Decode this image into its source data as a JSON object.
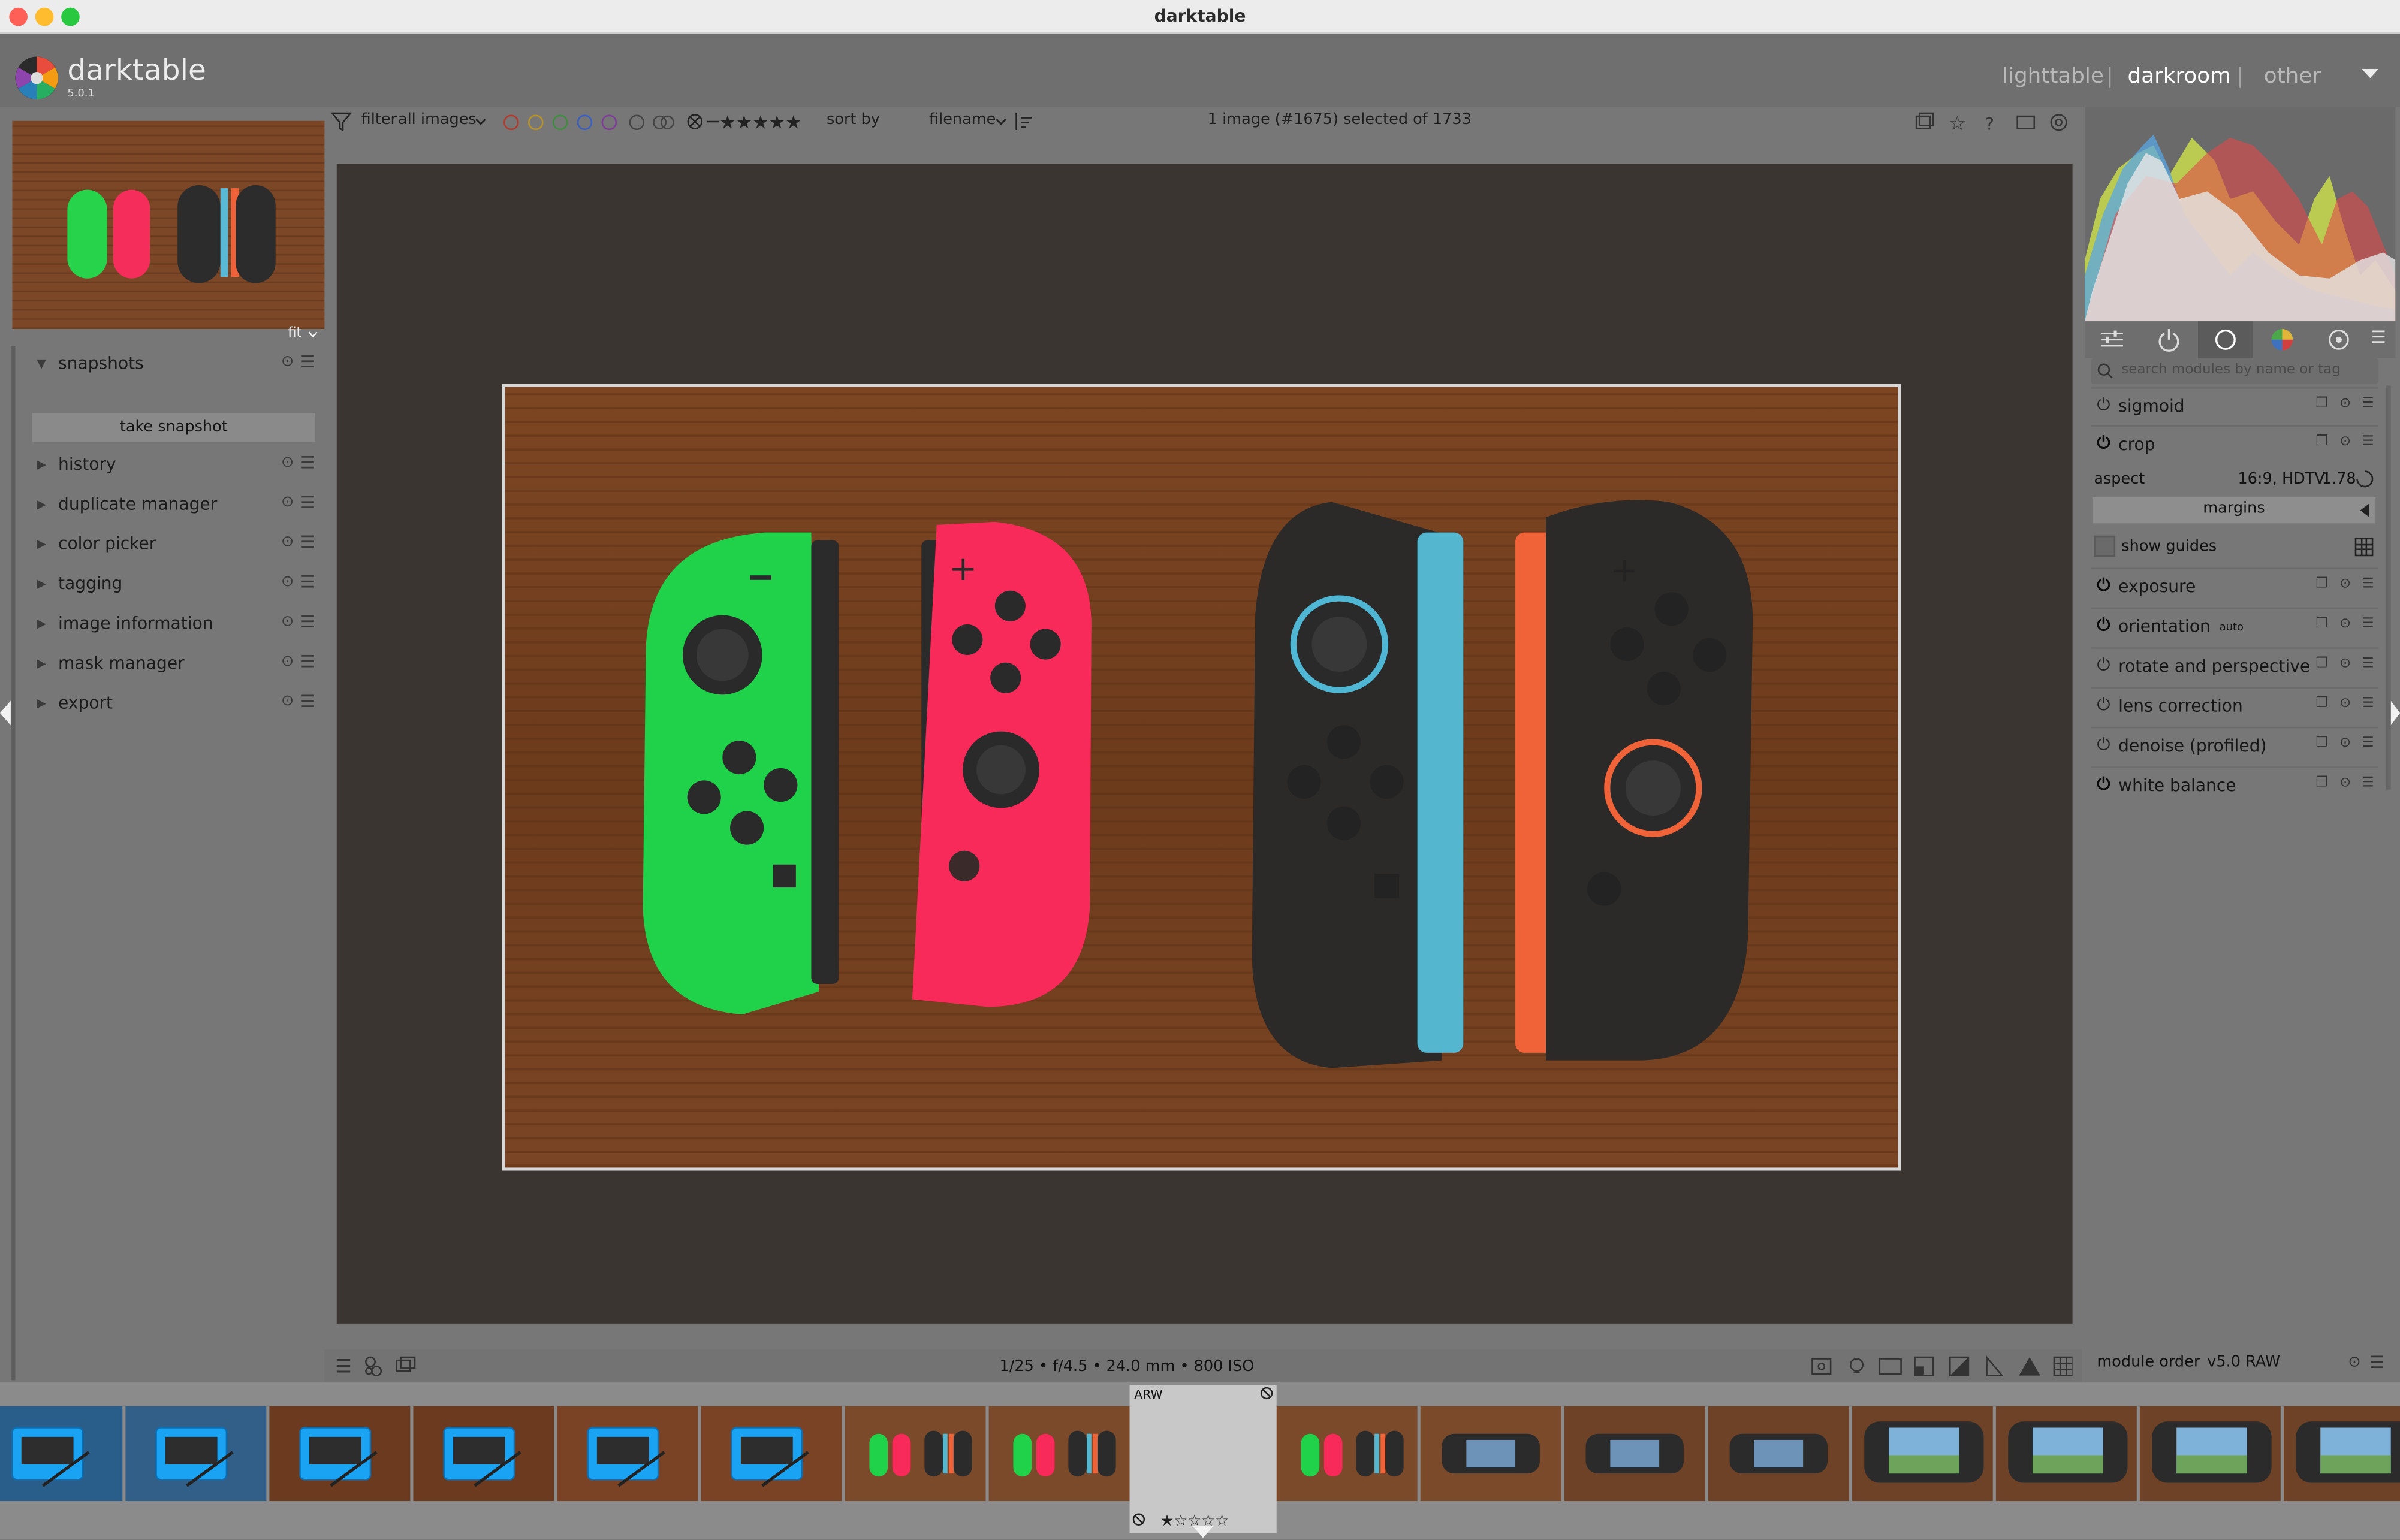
{
  "window": {
    "title": "darktable"
  },
  "app": {
    "name": "darktable",
    "version": "5.0.1"
  },
  "views": {
    "lighttable": "lighttable",
    "darkroom": "darkroom",
    "other": "other",
    "sep": "|"
  },
  "toolbar": {
    "filter_label": "filter",
    "filter_value": "all images",
    "sort_label": "sort by",
    "sort_value": "filename",
    "status": "1 image (#1675) selected of 1733"
  },
  "colors": {
    "panel": "#777777",
    "header": "#6f6f6f",
    "center_bg": "#3b3532",
    "accent_active": "#ffffff",
    "labels": [
      "#c0392b",
      "#c9a227",
      "#3f9b3f",
      "#3b5fc0",
      "#8e44ad"
    ]
  },
  "left_panel": {
    "fit_label": "fit",
    "snapshots_label": "snapshots",
    "take_snapshot": "take snapshot",
    "modules": [
      "history",
      "duplicate manager",
      "color picker",
      "tagging",
      "image information",
      "mask manager",
      "export"
    ]
  },
  "right_panel": {
    "search_placeholder": "search modules by name or tag",
    "modules_top": [
      "sigmoid",
      "crop"
    ],
    "crop": {
      "aspect_label": "aspect",
      "aspect_value": "16:9, HDTV",
      "aspect_ratio": "1.78",
      "margins_label": "margins",
      "show_guides_label": "show guides"
    },
    "modules_bottom": [
      "exposure",
      "orientation",
      "rotate and perspective",
      "lens correction",
      "denoise (profiled)",
      "white balance"
    ],
    "orientation_suffix": "auto",
    "module_order_label": "module order",
    "module_order_value": "v5.0 RAW"
  },
  "bottom_bar": {
    "exif": "1/25 • f/4.5 • 24.0 mm • 800 ISO"
  },
  "filmstrip": {
    "current_badge": "ARW",
    "current_index": 8,
    "thumbs": [
      {
        "kind": "console",
        "bg": "#2a5e8a"
      },
      {
        "kind": "console",
        "bg": "#315f88"
      },
      {
        "kind": "blue",
        "bg": "#6b3a1f"
      },
      {
        "kind": "blue",
        "bg": "#6b3a1f"
      },
      {
        "kind": "blue",
        "bg": "#7a4325"
      },
      {
        "kind": "blue",
        "bg": "#7a4325"
      },
      {
        "kind": "joycon",
        "bg": "#7a4a2b"
      },
      {
        "kind": "joycon",
        "bg": "#7a4a2b"
      },
      {
        "kind": "joycon",
        "bg": "#7a4a2b"
      },
      {
        "kind": "joycon",
        "bg": "#7a4a2b"
      },
      {
        "kind": "deck",
        "bg": "#7a4a2b"
      },
      {
        "kind": "deck",
        "bg": "#6e4226"
      },
      {
        "kind": "deck",
        "bg": "#6e4226"
      },
      {
        "kind": "deckgame",
        "bg": "#6e4226"
      },
      {
        "kind": "deckgame",
        "bg": "#6e4226"
      },
      {
        "kind": "deckgame",
        "bg": "#6e4226"
      },
      {
        "kind": "deckgame",
        "bg": "#6e4226"
      }
    ]
  }
}
